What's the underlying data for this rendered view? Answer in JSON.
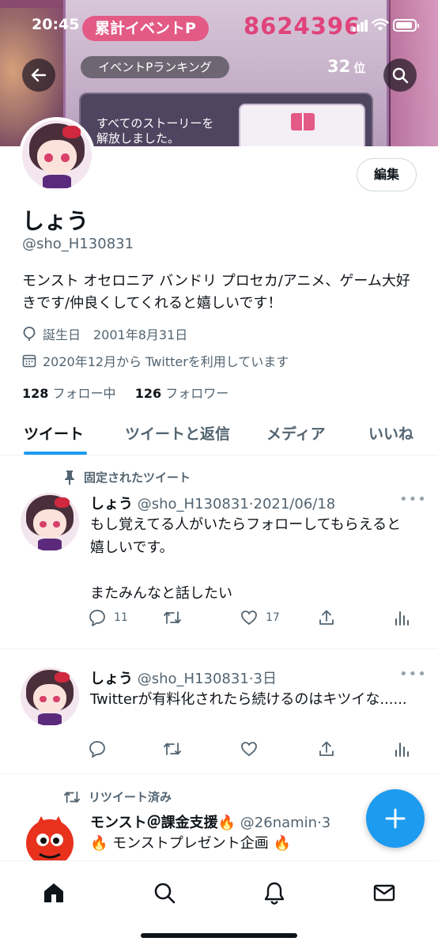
{
  "status_bar": {
    "time": "20:45"
  },
  "banner": {
    "event_label": "累計イベントP",
    "event_points": "8624396",
    "ranking_label": "イベントPランキング",
    "rank_value": "32",
    "rank_unit": "位",
    "story_text_line1": "すべてのストーリーを",
    "story_text_line2": "解放しました。"
  },
  "profile": {
    "edit_label": "編集",
    "name": "しょう",
    "handle": "@sho_H130831",
    "bio": "モンスト オセロニア バンドリ プロセカ/アニメ、ゲーム大好きです/仲良くしてくれると嬉しいです！",
    "birthday": "誕生日　2001年8月31日",
    "joined": "2020年12月から Twitterを利用しています",
    "following_count": "128",
    "following_label": "フォロー中",
    "followers_count": "126",
    "followers_label": "フォロワー"
  },
  "tabs": [
    {
      "label": "ツイート",
      "active": true
    },
    {
      "label": "ツイートと返信",
      "active": false
    },
    {
      "label": "メディア",
      "active": false
    },
    {
      "label": "いいね",
      "active": false
    }
  ],
  "tweets": [
    {
      "context": "固定されたツイート",
      "name": "しょう",
      "handle_time": "@sho_H130831·2021/06/18",
      "text": "もし覚えてる人がいたらフォローしてもらえると嬉しいです。\n\nまたみんなと話したい",
      "replies": "11",
      "retweets": "",
      "likes": "17"
    },
    {
      "context": "",
      "name": "しょう",
      "handle_time": "@sho_H130831·3日",
      "text": "Twitterが有料化されたら続けるのはキツイな......",
      "replies": "",
      "retweets": "",
      "likes": ""
    },
    {
      "context": "リツイート済み",
      "name": "モンスト＠課金支援🔥",
      "handle_time": "@26namin·3",
      "text": "🔥 モンストプレゼント企画 🔥",
      "replies": "",
      "retweets": "",
      "likes": ""
    }
  ],
  "colors": {
    "accent": "#1d9bf0",
    "text": "#0f1419",
    "secondary": "#536471",
    "event_pink": "#e35a86"
  },
  "icons": [
    "back-arrow-icon",
    "search-icon",
    "calendar-icon",
    "birthday-balloon-icon",
    "pin-icon",
    "retweet-icon",
    "reply-icon",
    "like-icon",
    "share-icon",
    "analytics-icon",
    "compose-icon",
    "home-icon",
    "notifications-icon",
    "messages-icon"
  ]
}
